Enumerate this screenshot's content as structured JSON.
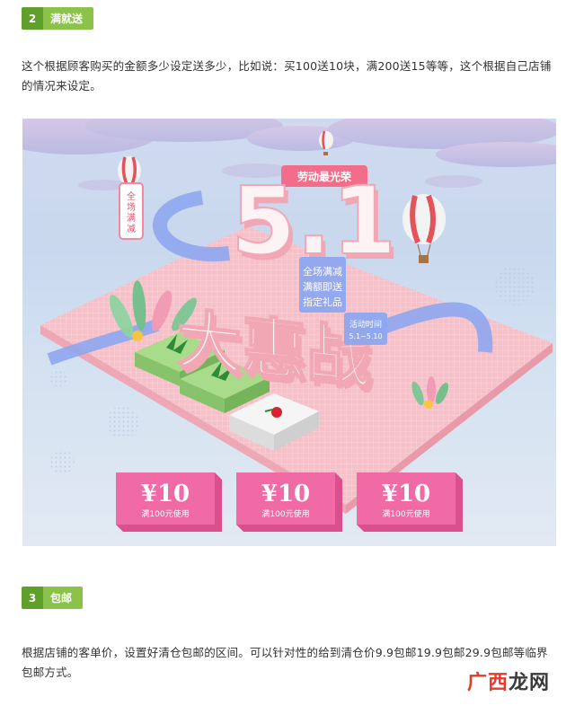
{
  "section2": {
    "number": "2",
    "title": "满就送",
    "text": "这个根据顾客购买的金额多少设定送多少，比如说：买100送10块，满200送15等等，这个根据自己店铺的情况来设定。"
  },
  "banner": {
    "badge_top": "劳动最光荣",
    "headline_number": "5.1",
    "headline_title": "大惠战",
    "side_tag": "全场满减",
    "promo_box": [
      "全场满减",
      "满额即送",
      "指定礼品"
    ],
    "time_label": "活动时间",
    "time_value": "5.1~5.10",
    "coupons": [
      {
        "price": "¥10",
        "condition": "满100元使用"
      },
      {
        "price": "¥10",
        "condition": "满100元使用"
      },
      {
        "price": "¥10",
        "condition": "满100元使用"
      }
    ],
    "colors": {
      "coupon_pink": "#f06aa6",
      "floor_pink": "#f4b9c4",
      "ribbon_blue": "#8ea6ef",
      "headline_white": "#fdf3f4",
      "headline_pink": "#f2a7b4"
    }
  },
  "section3": {
    "number": "3",
    "title": "包邮",
    "text": "根据店铺的客单价，设置好清仓包邮的区间。可以针对性的给到清仓价9.9包邮19.9包邮29.9包邮等临界包邮方式。"
  },
  "watermark": {
    "part1": "广西",
    "part2": "龙网"
  }
}
